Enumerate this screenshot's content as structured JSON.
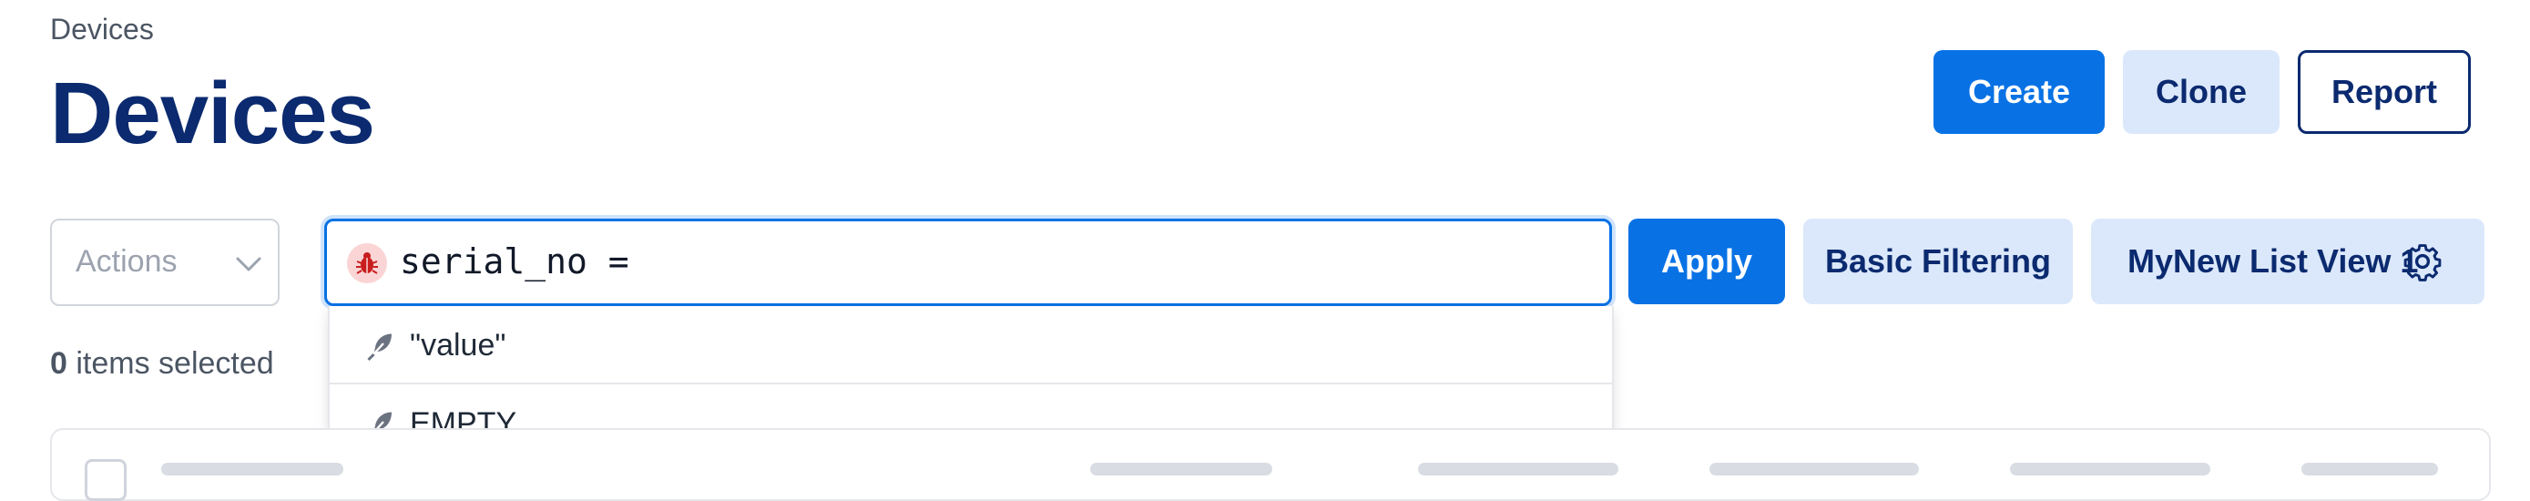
{
  "breadcrumb": "Devices",
  "page_title": "Devices",
  "header_buttons": {
    "create": "Create",
    "clone": "Clone",
    "report": "Report"
  },
  "toolbar": {
    "actions_placeholder": "Actions",
    "query_text": "serial_no =",
    "apply": "Apply",
    "basic_filtering": "Basic Filtering",
    "list_view": "MyNew List View 1"
  },
  "suggestions": [
    {
      "label": "\"value\"",
      "icon": "feather-icon"
    },
    {
      "label": "EMPTY",
      "icon": "feather-icon"
    }
  ],
  "selection": {
    "count": "0",
    "label": " items selected"
  },
  "colors": {
    "primary": "#0872e5",
    "soft": "#dbe8fb",
    "title": "#0b2a6f",
    "bug": "#c81e1e"
  }
}
